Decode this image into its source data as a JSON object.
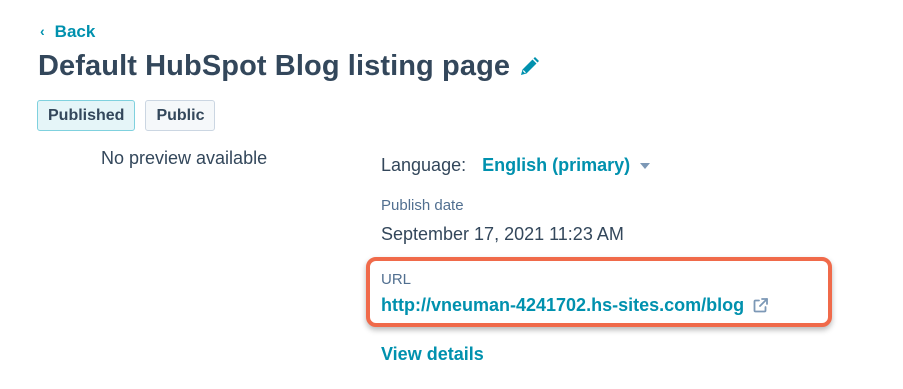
{
  "nav": {
    "back_label": "Back",
    "back_icon": "chevron-left-icon"
  },
  "header": {
    "title": "Default HubSpot Blog listing page",
    "edit_icon": "pencil-icon"
  },
  "tags": [
    {
      "label": "Published"
    },
    {
      "label": "Public"
    }
  ],
  "preview": {
    "text": "No preview available"
  },
  "details": {
    "language_label": "Language:",
    "language_value": "English (primary)",
    "publish_date_label": "Publish date",
    "publish_date_value": "September 17, 2021 11:23 AM",
    "url_label": "URL",
    "url_value": "http://vneuman-4241702.hs-sites.com/blog",
    "url_icon": "external-link-icon",
    "view_details_label": "View details"
  },
  "colors": {
    "link": "#0091ae",
    "text": "#33475b",
    "highlight_border": "#f06a4a",
    "published_tag_bg": "#e5f5f8"
  }
}
